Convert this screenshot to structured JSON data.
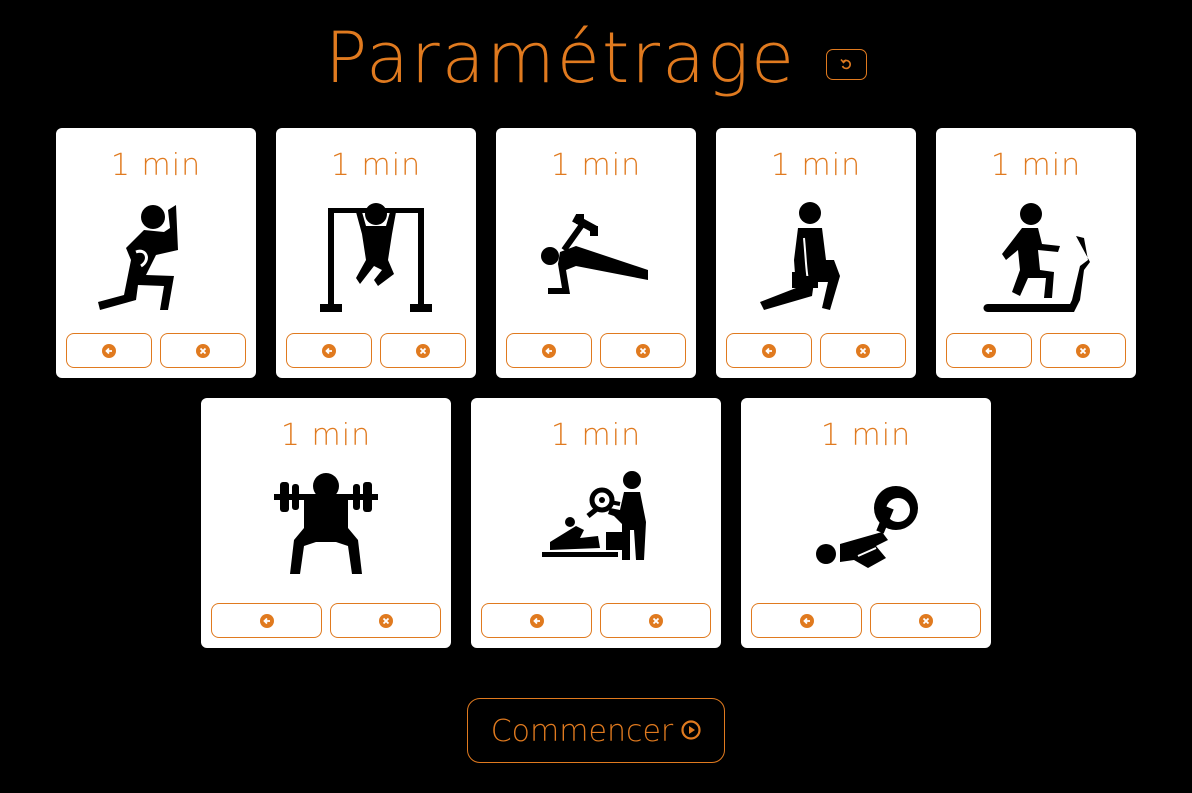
{
  "title": "Paramétrage",
  "accent_color": "#e07a1f",
  "reset_icon": "undo-icon",
  "exercises": [
    {
      "duration": "1 min",
      "icon": "lunge-icon"
    },
    {
      "duration": "1 min",
      "icon": "pull-up-bar-icon"
    },
    {
      "duration": "1 min",
      "icon": "plank-dumbbell-icon"
    },
    {
      "duration": "1 min",
      "icon": "kneeling-dumbbell-icon"
    },
    {
      "duration": "1 min",
      "icon": "treadmill-icon"
    },
    {
      "duration": "1 min",
      "icon": "barbell-squat-icon"
    },
    {
      "duration": "1 min",
      "icon": "assisted-bench-press-icon"
    },
    {
      "duration": "1 min",
      "icon": "medicine-ball-situp-icon"
    }
  ],
  "card_buttons": {
    "back_icon": "arrow-left-circle-icon",
    "remove_icon": "close-circle-icon"
  },
  "start": {
    "label": "Commencer",
    "icon": "play-circle-icon"
  }
}
